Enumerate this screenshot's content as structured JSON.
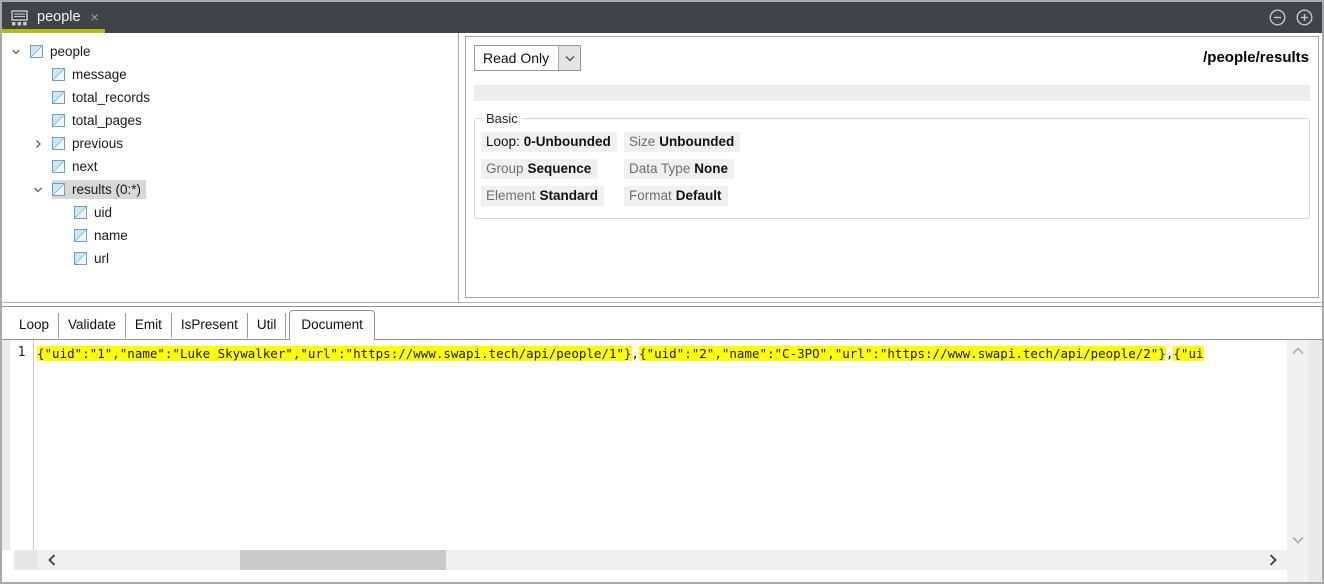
{
  "colors": {
    "tabbar_bg": "#3f4449",
    "active_tab_accent": "#b2bd18",
    "selection_gray": "#d8d8d8",
    "code_highlight": "#ffff00"
  },
  "titlebar": {
    "tab_title": "people",
    "close_glyph": "×",
    "icons": [
      "schema-grid-icon",
      "circled-minus-icon",
      "circled-plus-icon"
    ]
  },
  "tree": {
    "items": [
      {
        "label": "people",
        "level": 0,
        "chevron": "down",
        "selected": false
      },
      {
        "label": "message",
        "level": 1,
        "chevron": "none",
        "selected": false
      },
      {
        "label": "total_records",
        "level": 1,
        "chevron": "none",
        "selected": false
      },
      {
        "label": "total_pages",
        "level": 1,
        "chevron": "none",
        "selected": false
      },
      {
        "label": "previous",
        "level": 1,
        "chevron": "right",
        "selected": false
      },
      {
        "label": "next",
        "level": 1,
        "chevron": "none",
        "selected": false
      },
      {
        "label": "results (0:*)",
        "level": 1,
        "chevron": "down",
        "selected": true
      },
      {
        "label": "uid",
        "level": 2,
        "chevron": "none",
        "selected": false
      },
      {
        "label": "name",
        "level": 2,
        "chevron": "none",
        "selected": false
      },
      {
        "label": "url",
        "level": 2,
        "chevron": "none",
        "selected": false
      }
    ]
  },
  "inspector": {
    "mode_select": {
      "value": "Read Only"
    },
    "path": "/people/results",
    "group_title": "Basic",
    "properties": [
      {
        "label": "Loop:",
        "value": "0-Unbounded",
        "dark_label": true
      },
      {
        "label": "Size",
        "value": "Unbounded",
        "dark_label": false
      },
      {
        "label": "Group",
        "value": "Sequence",
        "dark_label": false
      },
      {
        "label": "Data Type",
        "value": "None",
        "dark_label": false
      },
      {
        "label": "Element",
        "value": "Standard",
        "dark_label": false
      },
      {
        "label": "Format",
        "value": "Default",
        "dark_label": false
      }
    ]
  },
  "bottom": {
    "tabs": [
      {
        "label": "Loop",
        "active": false
      },
      {
        "label": "Validate",
        "active": false
      },
      {
        "label": "Emit",
        "active": false
      },
      {
        "label": "IsPresent",
        "active": false
      },
      {
        "label": "Util",
        "active": false
      },
      {
        "label": "Document",
        "active": true
      }
    ],
    "editor": {
      "line_number": "1",
      "segments": [
        {
          "text": "{\"uid\":\"1\",\"name\":\"Luke Skywalker\",\"url\":\"https://www.swapi.tech/api/people/1\"}",
          "highlight": true
        },
        {
          "text": ",",
          "highlight": false
        },
        {
          "text": "{\"uid\":\"2\",\"name\":\"C-3PO\",\"url\":\"https://www.swapi.tech/api/people/2\"}",
          "highlight": true
        },
        {
          "text": ",",
          "highlight": false
        },
        {
          "text": "{\"ui",
          "highlight": true
        }
      ]
    }
  }
}
